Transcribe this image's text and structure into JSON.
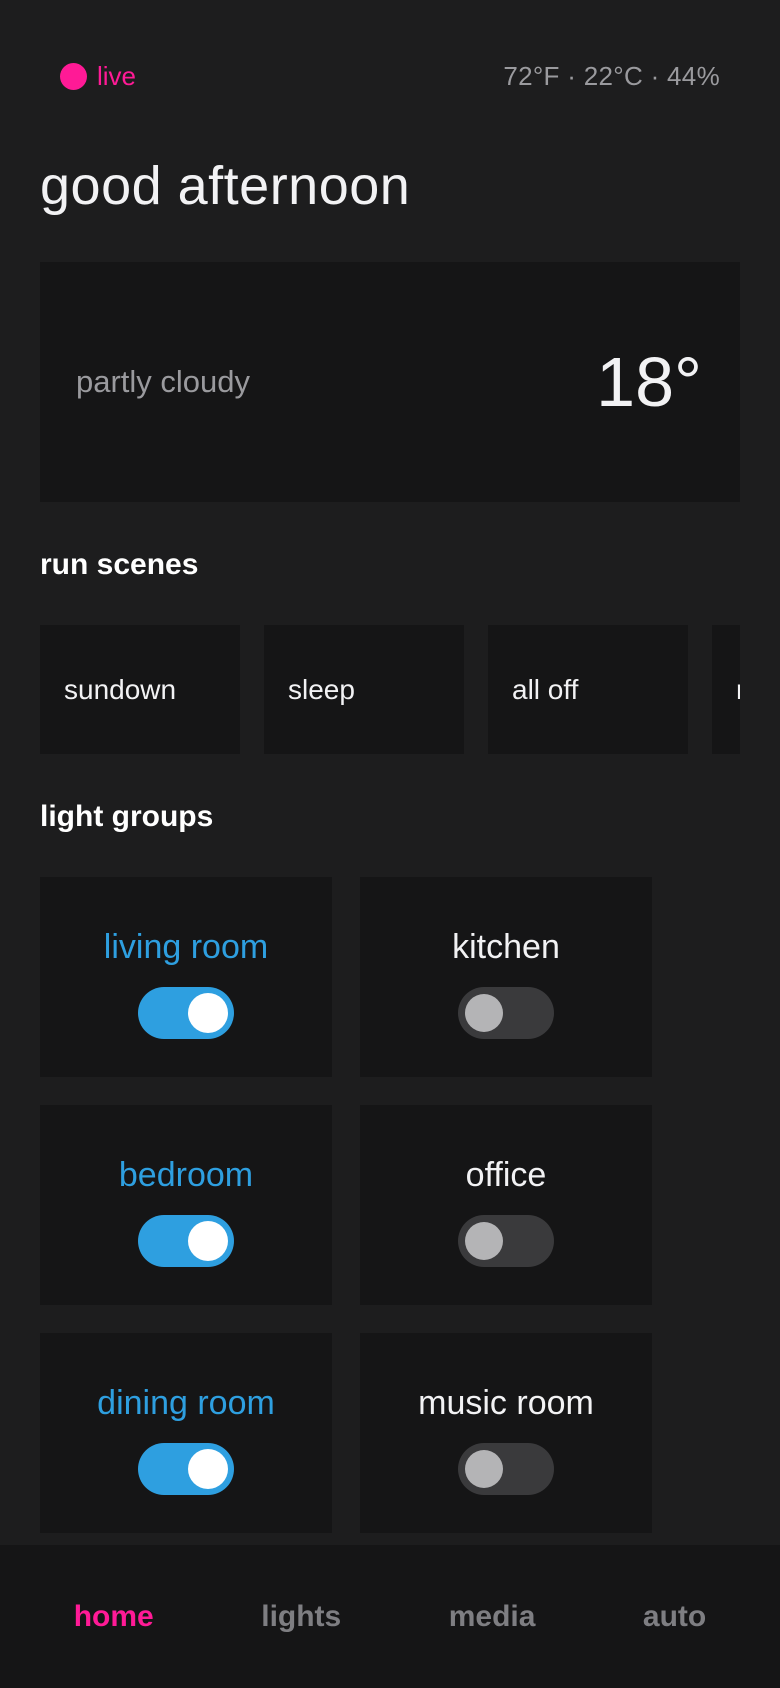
{
  "status": {
    "live_label": "live",
    "env_readout": "72°F · 22°C · 44%"
  },
  "greeting": "good afternoon",
  "weather": {
    "condition": "partly cloudy",
    "temperature": "18°"
  },
  "scenes": {
    "title": "run scenes",
    "items": [
      {
        "label": "sundown"
      },
      {
        "label": "sleep"
      },
      {
        "label": "all off"
      },
      {
        "label": "morning"
      }
    ]
  },
  "groups": {
    "title": "light groups",
    "items": [
      {
        "label": "living room",
        "on": true
      },
      {
        "label": "kitchen",
        "on": false
      },
      {
        "label": "bedroom",
        "on": true
      },
      {
        "label": "office",
        "on": false
      },
      {
        "label": "dining room",
        "on": true
      },
      {
        "label": "music room",
        "on": false
      }
    ]
  },
  "nav": {
    "items": [
      {
        "label": "home",
        "active": true
      },
      {
        "label": "lights",
        "active": false
      },
      {
        "label": "media",
        "active": false
      },
      {
        "label": "auto",
        "active": false
      }
    ]
  },
  "colors": {
    "accent": "#ff1a96",
    "toggle_on": "#2e9fe0",
    "background": "#1d1d1e",
    "card": "#151516"
  }
}
